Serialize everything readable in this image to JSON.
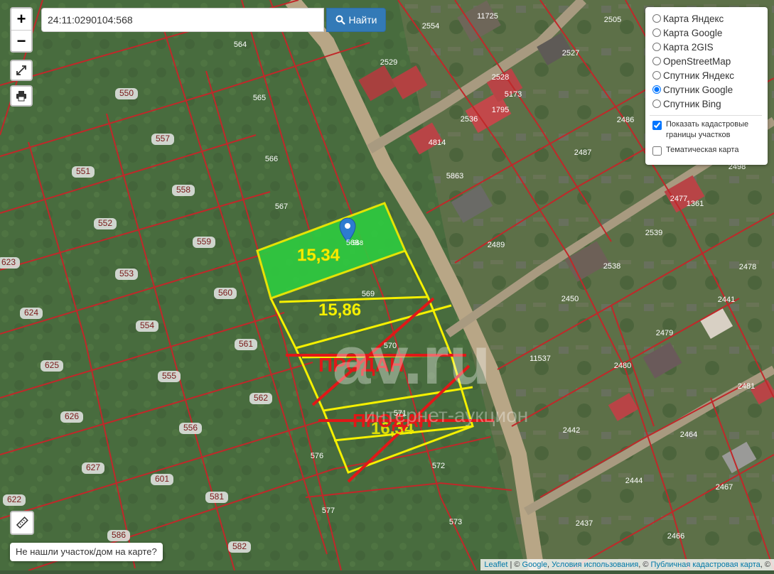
{
  "search": {
    "value": "24:11:0290104:568",
    "button_label": "Найти"
  },
  "zoom": {
    "in_label": "+",
    "out_label": "−"
  },
  "layers": {
    "base": [
      {
        "label": "Карта Яндекс",
        "checked": false
      },
      {
        "label": "Карта Google",
        "checked": false
      },
      {
        "label": "Карта 2GIS",
        "checked": false
      },
      {
        "label": "OpenStreetMap",
        "checked": false
      },
      {
        "label": "Спутник Яндекс",
        "checked": false
      },
      {
        "label": "Спутник Google",
        "checked": true
      },
      {
        "label": "Спутник Bing",
        "checked": false
      }
    ],
    "overlays": [
      {
        "label": "Показать кадастровые границы участков",
        "checked": true
      },
      {
        "label": "Тематическая карта",
        "checked": false
      }
    ]
  },
  "not_found_label": "Не нашли участок/дом на карте?",
  "attribution": {
    "leaflet": "Leaflet",
    "sep1": " | © ",
    "google": "Google",
    "sep2": ", ",
    "terms": "Условия использования",
    "sep3": ", © ",
    "pkk": "Публичная кадастровая карта",
    "tail": ", ©"
  },
  "plots": {
    "price_1": "15,34",
    "price_2": "15,86",
    "price_3": "16,34",
    "sold_label_1": "ПРОДАН",
    "sold_label_2": "ПРОДАН",
    "watermark_main": "av.ru",
    "watermark_sub": "интернет-аукцион",
    "marker_plot_number": "568"
  },
  "parcel_numbers": [
    "564",
    "565",
    "566",
    "567",
    "568",
    "569",
    "570",
    "571",
    "572",
    "573",
    "576",
    "577",
    "581",
    "582",
    "586",
    "601",
    "622",
    "623",
    "624",
    "625",
    "626",
    "627",
    "550",
    "551",
    "552",
    "553",
    "554",
    "555",
    "556",
    "557",
    "558",
    "559",
    "560",
    "561",
    "562",
    "2554",
    "2505",
    "2529",
    "2527",
    "2528",
    "1795",
    "2536",
    "4814",
    "2486",
    "5863",
    "2487",
    "2498",
    "2477",
    "1361",
    "2539",
    "2489",
    "2538",
    "2478",
    "2450",
    "2441",
    "2479",
    "11537",
    "2480",
    "2481",
    "2442",
    "2464",
    "2444",
    "2467",
    "2437",
    "2466",
    "11725",
    "5173"
  ],
  "colors": {
    "search_button": "#337ab7",
    "plot_highlight": "#2ecc40",
    "plot_outline": "#f5f000",
    "cadastre_lines": "#c0282a",
    "sold_text": "#e01818"
  }
}
